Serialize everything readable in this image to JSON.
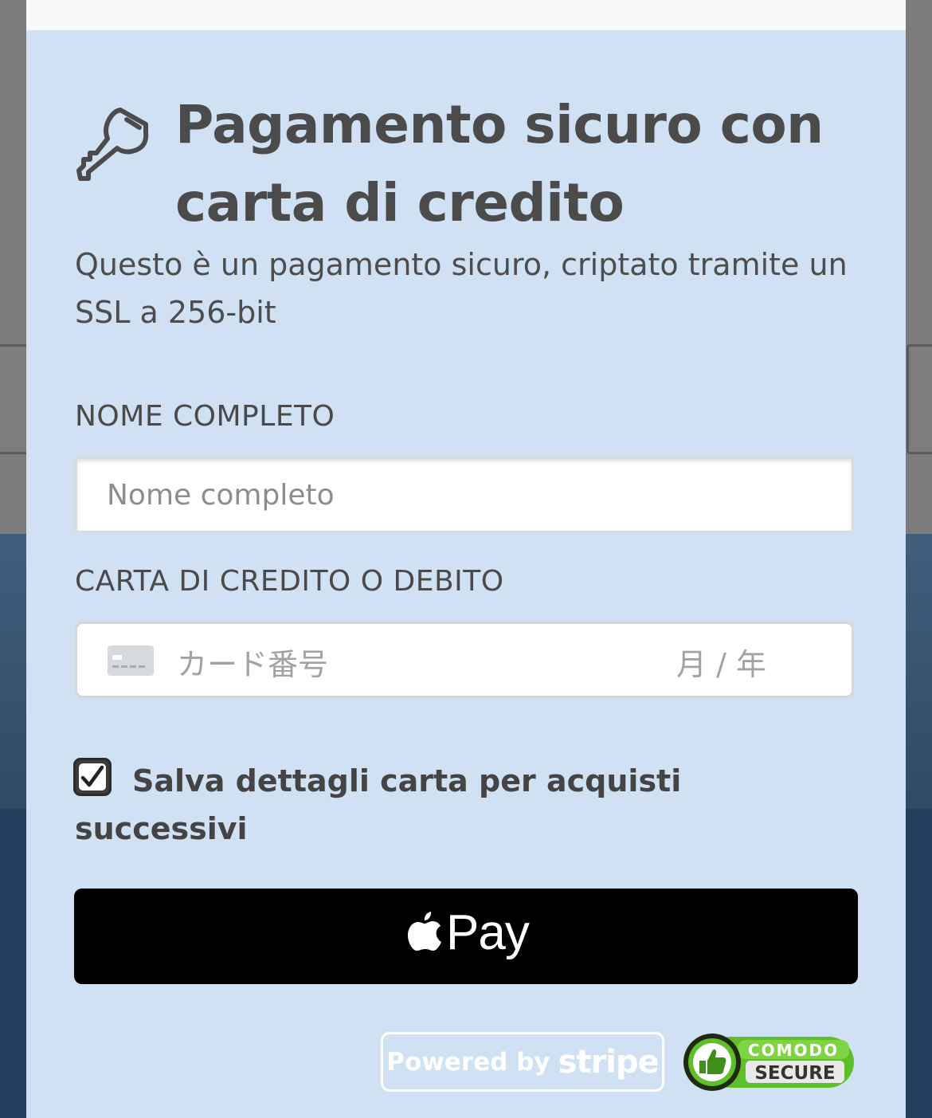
{
  "modal": {
    "title": "Pagamento sicuro con carta di credito",
    "subtitle": "Questo è un pagamento sicuro, criptato tramite un SSL a 256-bit",
    "name_label": "NOME COMPLETO",
    "name_placeholder": "Nome completo",
    "card_label": "CARTA DI CREDITO O DEBITO",
    "card_number_placeholder": "カード番号",
    "card_expiry_placeholder": "月 / 年",
    "save_checkbox_checked": true,
    "save_label": "Salva dettagli carta per acquisti successivi",
    "apple_pay_label": "Pay",
    "stripe_badge": {
      "powered_by": "Powered by",
      "brand": "stripe"
    },
    "comodo_badge": {
      "line1": "COMODO",
      "line2": "SECURE"
    }
  },
  "colors": {
    "modal_bg": "#cfe1f2",
    "text": "#4b4b4b",
    "apple_pay_bg": "#000000",
    "comodo_green": "#5fbf2a"
  },
  "icons": [
    "key-icon",
    "credit-card-icon",
    "check-icon",
    "apple-icon",
    "thumbs-up-icon"
  ]
}
